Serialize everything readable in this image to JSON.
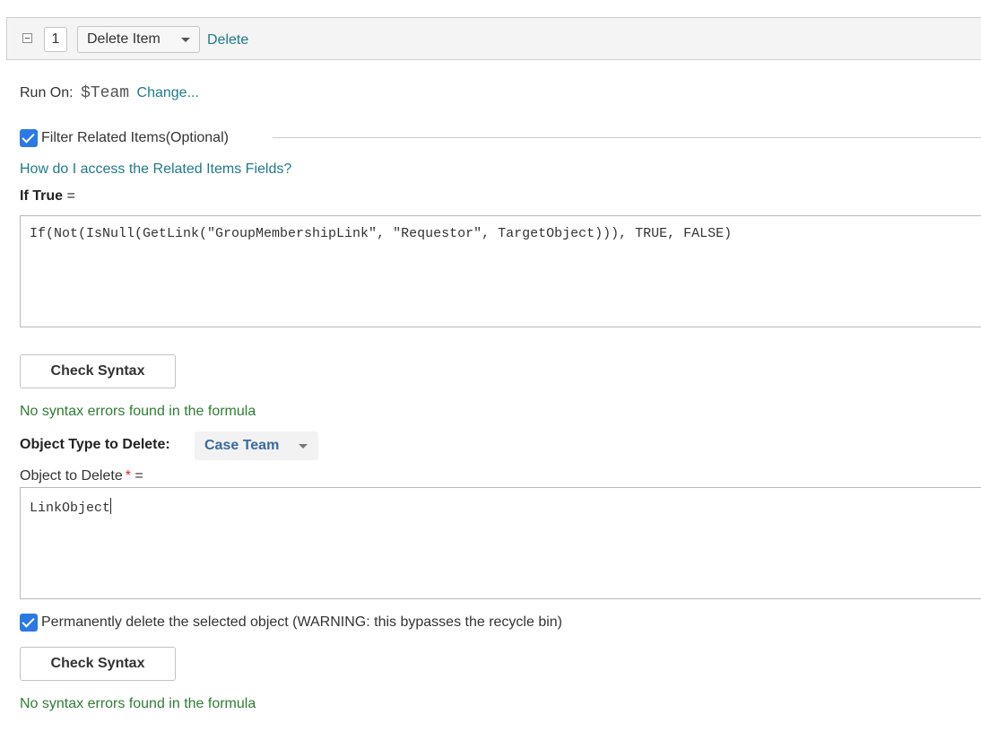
{
  "step": {
    "number": "1",
    "action_select_value": "Delete Item",
    "delete_link": "Delete"
  },
  "run_on": {
    "label": "Run On:",
    "value": "$Team",
    "change_link": "Change..."
  },
  "filter": {
    "checked": true,
    "label": "Filter Related Items(Optional)",
    "help_link": "How do I access the Related Items Fields?",
    "if_true_label": "If True",
    "if_true_eq": " =",
    "formula": "If(Not(IsNull(GetLink(\"GroupMembershipLink\", \"Requestor\", TargetObject))), TRUE, FALSE)",
    "check_syntax_label": "Check Syntax",
    "status": "No syntax errors found in the formula"
  },
  "object_type": {
    "label": "Object Type to Delete:",
    "selected": "Case Team"
  },
  "object_to_delete": {
    "label": "Object to Delete",
    "required_mark": "*",
    "eq": " =",
    "value": "LinkObject"
  },
  "permanent_delete": {
    "checked": true,
    "label": "Permanently delete the selected object (WARNING: this bypasses the recycle bin)"
  },
  "second_check": {
    "check_syntax_label": "Check Syntax",
    "status": "No syntax errors found in the formula"
  },
  "colors": {
    "link": "#1f7a8c",
    "success": "#2e7d32",
    "checkbox": "#2a7ae2",
    "required": "#dd2222"
  }
}
